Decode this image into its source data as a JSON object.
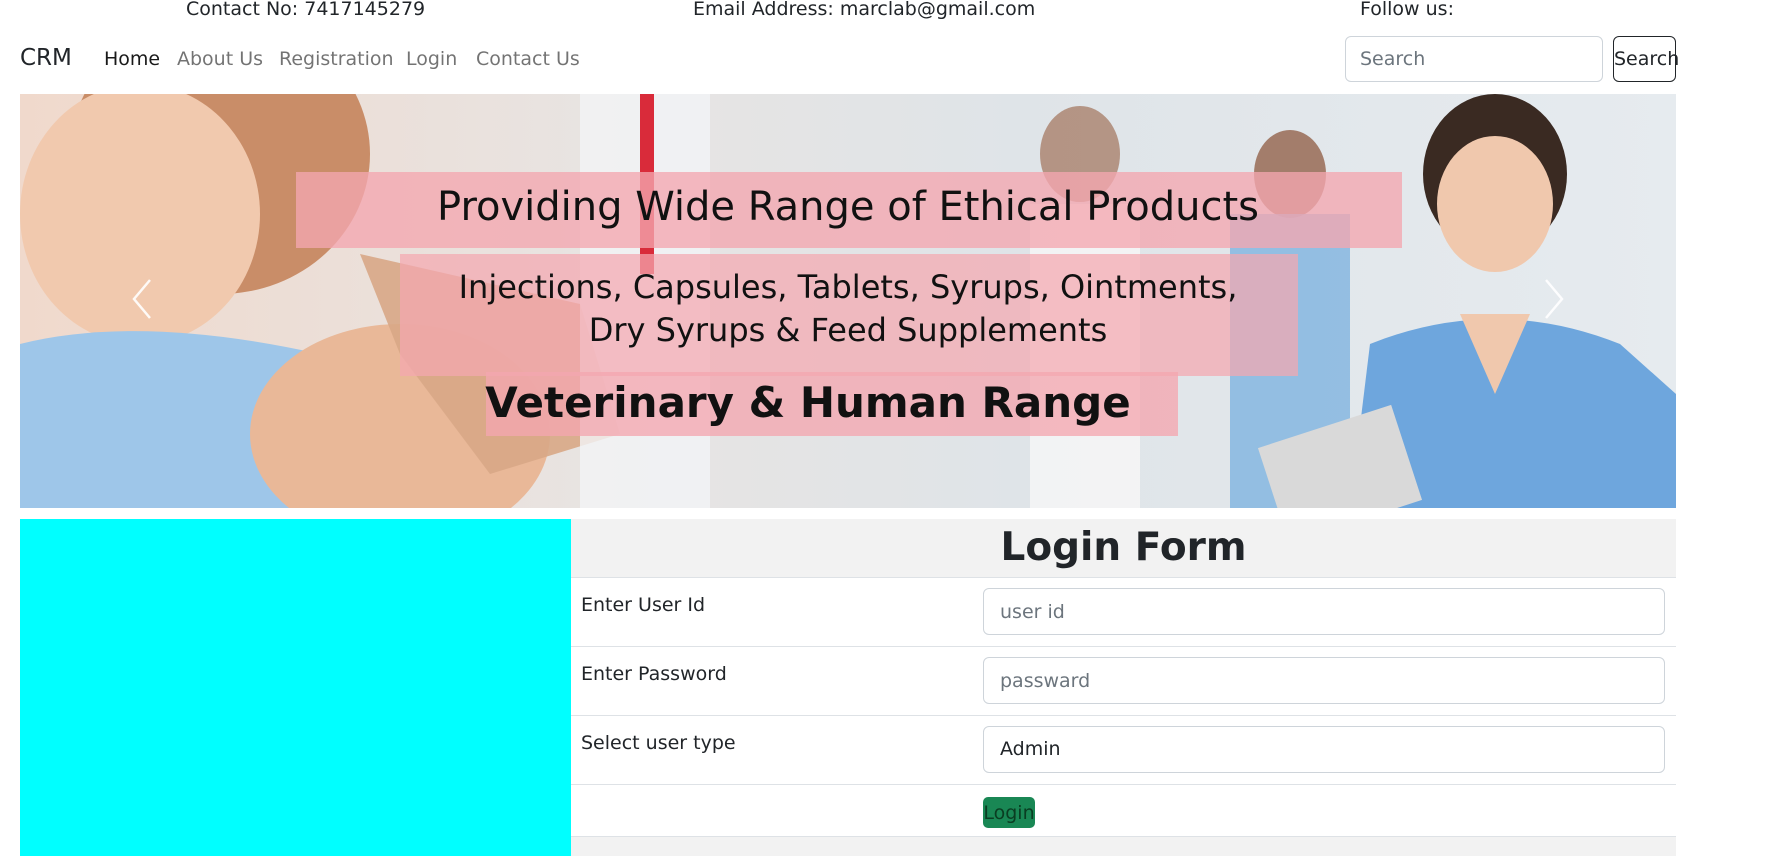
{
  "topbar": {
    "contact": "Contact No: 7417145279",
    "email": "Email Address: marclab@gmail.com",
    "follow": "Follow us:"
  },
  "navbar": {
    "brand": "CRM",
    "links": [
      "Home",
      "About Us",
      "Registration",
      "Login",
      "Contact Us"
    ],
    "active": "Home",
    "search_placeholder": "Search",
    "search_button": "Search"
  },
  "banner": {
    "headline": "Providing Wide Range of Ethical Products",
    "products_line1": "Injections,  Capsules,  Tablets,  Syrups,  Ointments,",
    "products_line2": "Dry  Syrups  &  Feed  Supplements",
    "range": "Veterinary & Human Range",
    "prev_icon": "chevron-left-icon",
    "next_icon": "chevron-right-icon"
  },
  "login_form": {
    "title": "Login Form",
    "user_id_label": "Enter User Id",
    "user_id_placeholder": "user id",
    "password_label": "Enter Password",
    "password_placeholder": "passward",
    "user_type_label": "Select user type",
    "user_type_value": "Admin",
    "submit": "Login"
  },
  "colors": {
    "sidebar_panel": "#00ffff",
    "login_button": "#198754",
    "banner_band": "#f4a7b0"
  }
}
